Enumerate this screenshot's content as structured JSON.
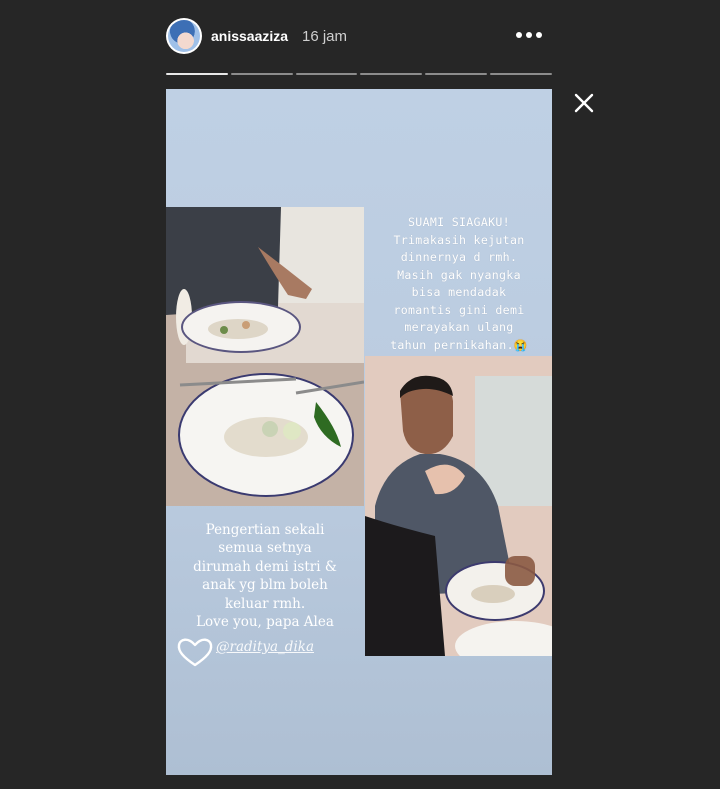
{
  "header": {
    "username": "anissaaziza",
    "time_ago": "16 jam",
    "more_icon": "more-horizontal-icon",
    "close_icon": "close-icon"
  },
  "progress": {
    "segments": 6,
    "active_index": 0
  },
  "story": {
    "caption_top": [
      "SUAMI SIAGAKU!",
      "Trimakasih kejutan",
      "dinnernya d rmh.",
      "Masih gak nyangka",
      "bisa mendadak",
      "romantis gini demi",
      "merayakan ulang",
      "tahun pernikahan."
    ],
    "caption_emoji": "😭",
    "caption_bottom": [
      "Pengertian sekali",
      "semua setnya",
      "dirumah demi istri &",
      "anak yg blm boleh",
      "keluar rmh.",
      "Love you, papa Alea"
    ],
    "mention": "@raditya_dika"
  },
  "colors": {
    "background": "#262626",
    "story_bg": "#bfd0e4",
    "text": "#ffffff"
  }
}
